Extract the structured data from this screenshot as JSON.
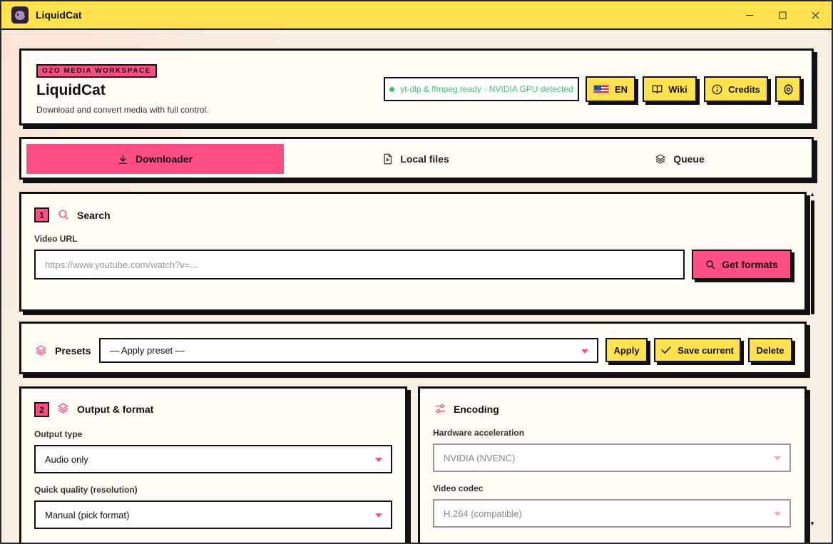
{
  "window": {
    "title": "LiquidCat",
    "controls": {
      "minimize": "—",
      "maximize": "☐",
      "close": "✕"
    }
  },
  "header": {
    "tag": "OZO MEDIA WORKSPACE",
    "app_name": "LiquidCat",
    "subtitle": "Download and convert media with full control.",
    "status": "yt-dlp & ffmpeg ready · NVIDIA GPU detected",
    "status_color": "#3cc36a",
    "buttons": {
      "language": "EN",
      "wiki": "Wiki",
      "credits": "Credits"
    }
  },
  "tabs": [
    {
      "label": "Downloader",
      "icon": "download-icon",
      "active": true
    },
    {
      "label": "Local files",
      "icon": "file-play-icon",
      "active": false
    },
    {
      "label": "Queue",
      "icon": "layers-icon",
      "active": false
    }
  ],
  "search": {
    "step": "1",
    "title": "Search",
    "url_label": "Video URL",
    "url_value": "",
    "url_placeholder": "https://www.youtube.com/watch?v=...",
    "get_formats": "Get formats"
  },
  "presets": {
    "title": "Presets",
    "selected": "— Apply preset —",
    "apply": "Apply",
    "save_current": "Save current",
    "delete": "Delete"
  },
  "output": {
    "step": "2",
    "title": "Output & format",
    "output_type_label": "Output type",
    "output_type_value": "Audio only",
    "quick_quality_label": "Quick quality (resolution)",
    "quick_quality_value": "Manual (pick format)"
  },
  "encoding": {
    "title": "Encoding",
    "hw_label": "Hardware acceleration",
    "hw_value": "NVIDIA (NVENC)",
    "codec_label": "Video codec",
    "codec_value": "H.264 (compatible)"
  },
  "colors": {
    "accent_pink": "#ff4d86",
    "accent_yellow": "#ffe24d",
    "background": "#f7efe1"
  }
}
